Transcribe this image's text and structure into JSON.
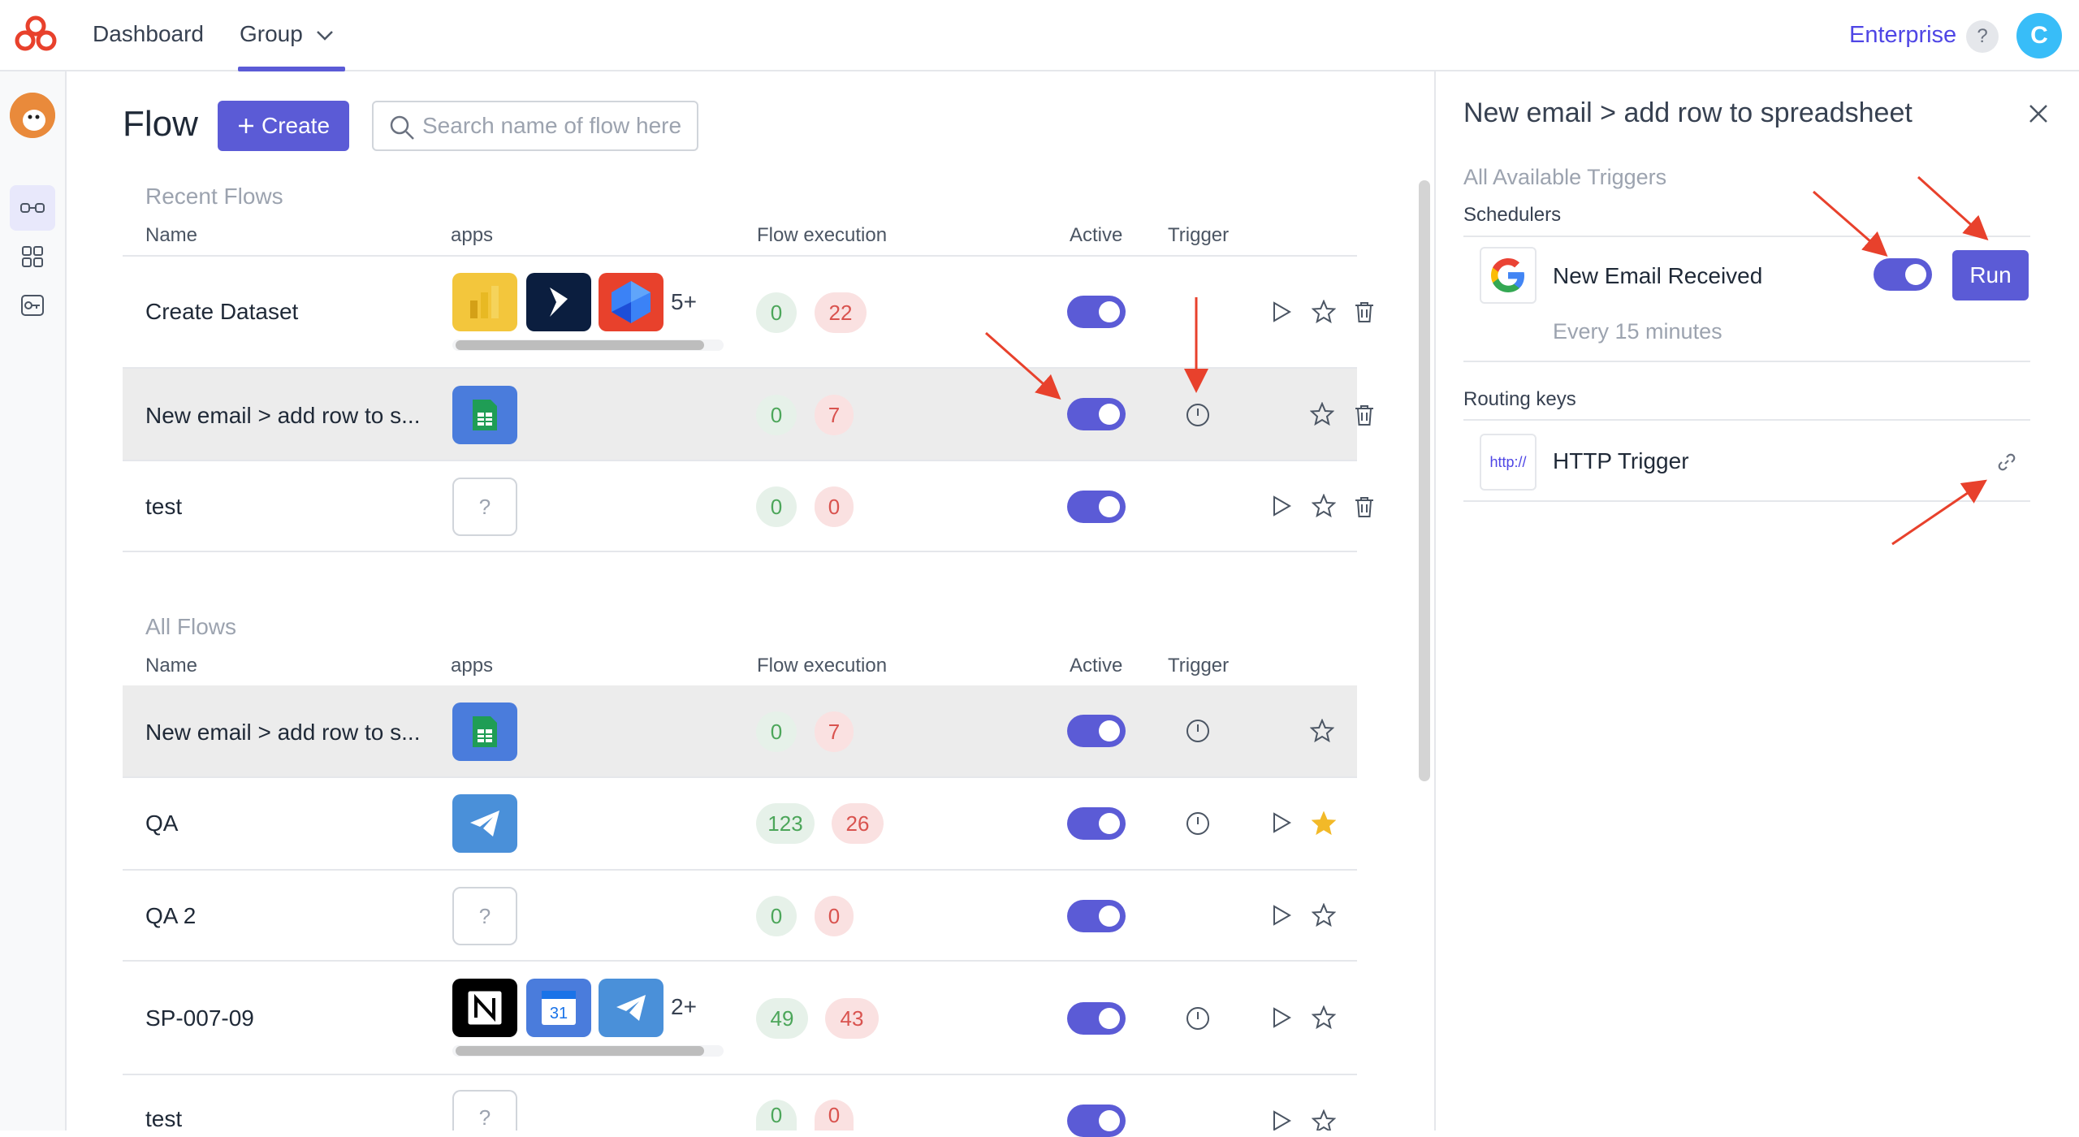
{
  "nav": {
    "dashboard": "Dashboard",
    "group": "Group",
    "enterprise": "Enterprise",
    "help": "?",
    "user_initial": "C"
  },
  "page": {
    "title": "Flow",
    "create_label": "Create",
    "search_placeholder": "Search name of flow here"
  },
  "columns": {
    "name": "Name",
    "apps": "apps",
    "execution": "Flow execution",
    "active": "Active",
    "trigger": "Trigger"
  },
  "recent": {
    "title": "Recent Flows",
    "rows": [
      {
        "name": "Create Dataset",
        "more": "5+",
        "ok": "0",
        "fail": "22"
      },
      {
        "name": "New email > add row to s...",
        "ok": "0",
        "fail": "7"
      },
      {
        "name": "test",
        "unknown": "?",
        "ok": "0",
        "fail": "0"
      }
    ]
  },
  "all": {
    "title": "All Flows",
    "rows": [
      {
        "name": "New email > add row to s...",
        "ok": "0",
        "fail": "7"
      },
      {
        "name": "QA",
        "ok": "123",
        "fail": "26"
      },
      {
        "name": "QA 2",
        "unknown": "?",
        "ok": "0",
        "fail": "0"
      },
      {
        "name": "SP-007-09",
        "more": "2+",
        "ok": "49",
        "fail": "43"
      },
      {
        "name": "test",
        "unknown": "?",
        "ok": "0",
        "fail": "0"
      }
    ]
  },
  "calendar_day": "31",
  "panel": {
    "title": "New email > add row to spreadsheet",
    "available": "All Available Triggers",
    "schedulers": "Schedulers",
    "trigger_name": "New Email Received",
    "trigger_interval": "Every 15 minutes",
    "run_label": "Run",
    "routing": "Routing keys",
    "http_icon_text": "http://",
    "http_name": "HTTP Trigger"
  },
  "colors": {
    "accent": "#5b5bd6",
    "success": "#4ca65a",
    "danger": "#d9534f",
    "annotation": "#e8412c"
  }
}
